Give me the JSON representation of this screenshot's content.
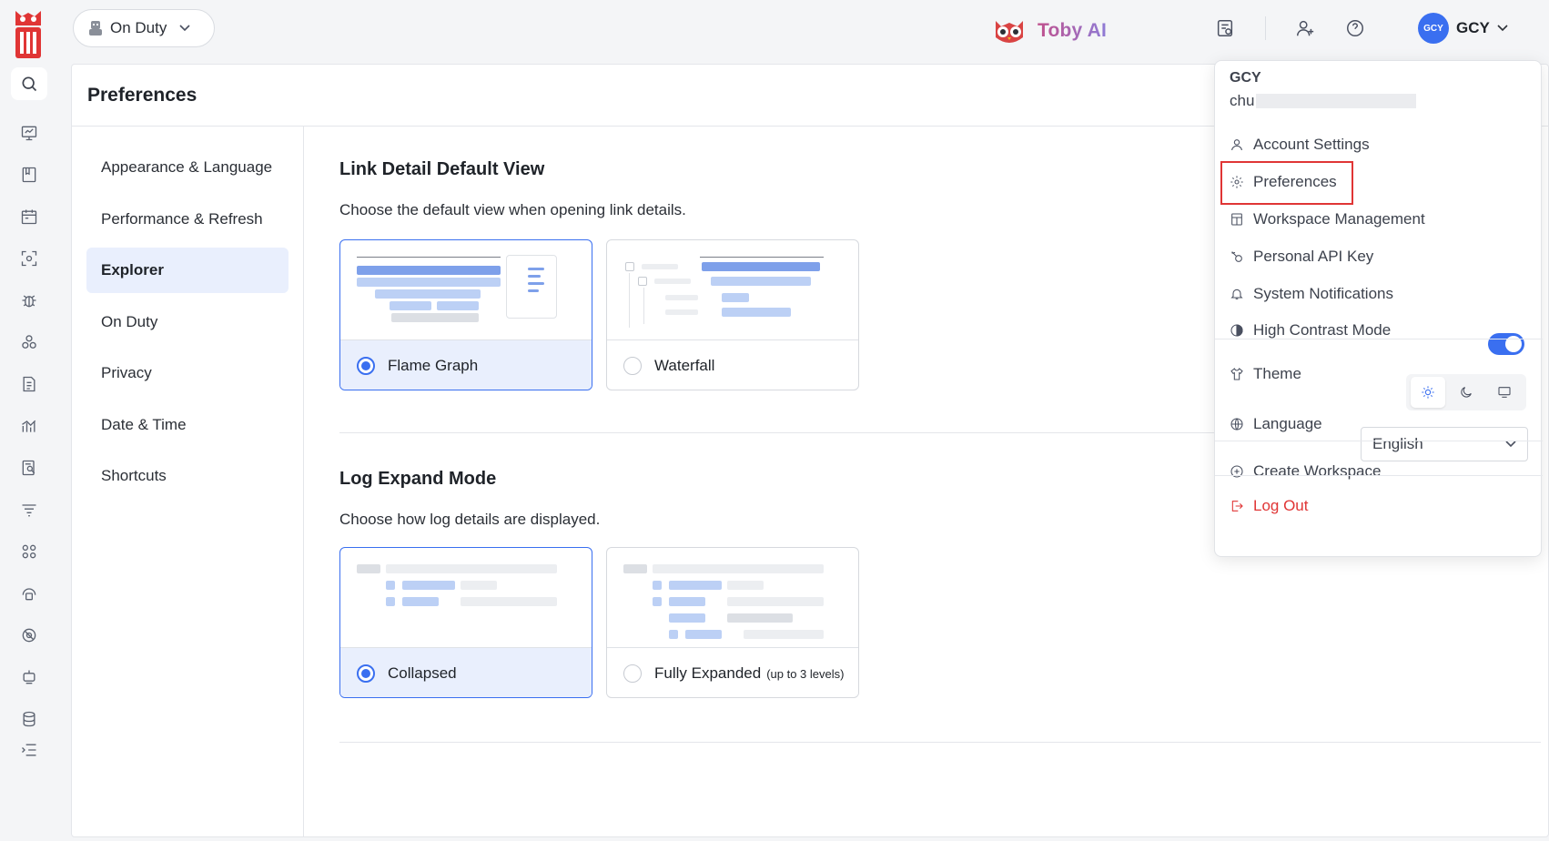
{
  "topbar": {
    "duty_select": "On Duty",
    "assistant_name": "Toby AI",
    "user_avatar": "GCY",
    "user_name": "GCY"
  },
  "page": {
    "title": "Preferences"
  },
  "subnav": {
    "items": [
      "Appearance & Language",
      "Performance & Refresh",
      "Explorer",
      "On Duty",
      "Privacy",
      "Date & Time",
      "Shortcuts"
    ],
    "active": "Explorer"
  },
  "sections": {
    "link_detail": {
      "title": "Link Detail Default View",
      "description": "Choose the default view when opening link details.",
      "options": [
        {
          "label": "Flame Graph",
          "selected": true
        },
        {
          "label": "Waterfall",
          "selected": false
        }
      ]
    },
    "log_expand": {
      "title": "Log Expand Mode",
      "description": "Choose how log details are displayed.",
      "options": [
        {
          "label": "Collapsed",
          "note": "",
          "selected": true
        },
        {
          "label": "Fully Expanded",
          "note": "(up to 3 levels)",
          "selected": false
        }
      ]
    }
  },
  "user_menu": {
    "name": "GCY",
    "email_prefix": "chu",
    "items": {
      "account_settings": "Account Settings",
      "preferences": "Preferences",
      "workspace_management": "Workspace Management",
      "personal_api_key": "Personal API Key",
      "system_notifications": "System Notifications",
      "high_contrast_mode": "High Contrast Mode",
      "theme": "Theme",
      "language": "Language",
      "create_workspace": "Create Workspace",
      "log_out": "Log Out"
    },
    "high_contrast_enabled": true,
    "theme_selected": "light",
    "language_value": "English"
  },
  "colors": {
    "accent": "#3a6ff0",
    "danger": "#e03535",
    "selected_bg": "#e9effd"
  }
}
